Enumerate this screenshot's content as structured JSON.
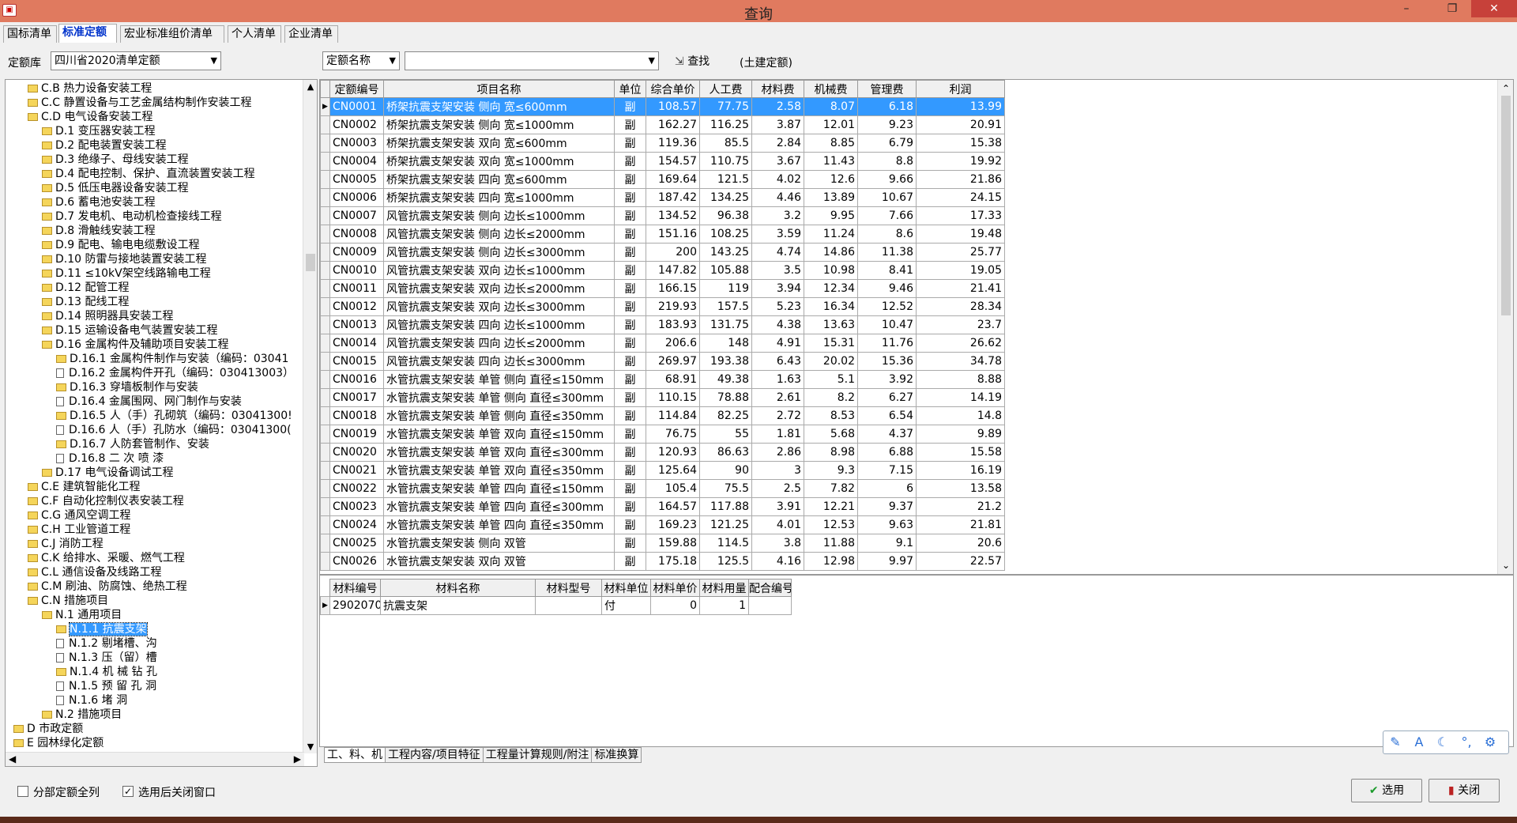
{
  "window": {
    "title": "查询",
    "app_icon": "app-logo-icon",
    "controls": {
      "minimize": "–",
      "maximize": "❐",
      "close": "✕"
    }
  },
  "tabs": [
    {
      "label": "国标清单"
    },
    {
      "label": "标准定额"
    },
    {
      "label": "宏业标准组价清单"
    },
    {
      "label": "个人清单"
    },
    {
      "label": "企业清单"
    }
  ],
  "topbar": {
    "library_label": "定额库",
    "library_value": "四川省2020清单定额",
    "field_value": "定额名称",
    "search_value": "",
    "find_label": "查找",
    "scope_text": "(土建定额)"
  },
  "tree": [
    {
      "label": "C.B 热力设备安装工程",
      "level": 2,
      "type": "folder"
    },
    {
      "label": "C.C 静置设备与工艺金属结构制作安装工程",
      "level": 2,
      "type": "folder"
    },
    {
      "label": "C.D 电气设备安装工程",
      "level": 2,
      "type": "folder-open"
    },
    {
      "label": "D.1 变压器安装工程",
      "level": 3,
      "type": "folder"
    },
    {
      "label": "D.2 配电装置安装工程",
      "level": 3,
      "type": "folder"
    },
    {
      "label": "D.3 绝缘子、母线安装工程",
      "level": 3,
      "type": "folder"
    },
    {
      "label": "D.4 配电控制、保护、直流装置安装工程",
      "level": 3,
      "type": "folder"
    },
    {
      "label": "D.5 低压电器设备安装工程",
      "level": 3,
      "type": "folder"
    },
    {
      "label": "D.6 蓄电池安装工程",
      "level": 3,
      "type": "folder"
    },
    {
      "label": "D.7 发电机、电动机检查接线工程",
      "level": 3,
      "type": "folder"
    },
    {
      "label": "D.8 滑触线安装工程",
      "level": 3,
      "type": "folder"
    },
    {
      "label": "D.9 配电、输电电缆敷设工程",
      "level": 3,
      "type": "folder"
    },
    {
      "label": "D.10 防雷与接地装置安装工程",
      "level": 3,
      "type": "folder"
    },
    {
      "label": "D.11 ≤10kV架空线路输电工程",
      "level": 3,
      "type": "folder"
    },
    {
      "label": "D.12 配管工程",
      "level": 3,
      "type": "folder"
    },
    {
      "label": "D.13 配线工程",
      "level": 3,
      "type": "folder"
    },
    {
      "label": "D.14 照明器具安装工程",
      "level": 3,
      "type": "folder"
    },
    {
      "label": "D.15 运输设备电气装置安装工程",
      "level": 3,
      "type": "folder"
    },
    {
      "label": "D.16 金属构件及辅助项目安装工程",
      "level": 3,
      "type": "folder-open"
    },
    {
      "label": "D.16.1 金属构件制作与安装（编码：03041",
      "level": 4,
      "type": "folder"
    },
    {
      "label": "D.16.2 金属构件开孔（编码：030413003）",
      "level": 4,
      "type": "doc"
    },
    {
      "label": "D.16.3 穿墙板制作与安装",
      "level": 4,
      "type": "folder"
    },
    {
      "label": "D.16.4 金属围网、网门制作与安装",
      "level": 4,
      "type": "doc"
    },
    {
      "label": "D.16.5 人（手）孔砌筑（编码：03041300!",
      "level": 4,
      "type": "folder"
    },
    {
      "label": "D.16.6 人（手）孔防水（编码：03041300(",
      "level": 4,
      "type": "doc"
    },
    {
      "label": "D.16.7 人防套管制作、安装",
      "level": 4,
      "type": "folder"
    },
    {
      "label": "D.16.8 二 次 喷 漆",
      "level": 4,
      "type": "doc"
    },
    {
      "label": "D.17 电气设备调试工程",
      "level": 3,
      "type": "folder"
    },
    {
      "label": "C.E 建筑智能化工程",
      "level": 2,
      "type": "folder"
    },
    {
      "label": "C.F 自动化控制仪表安装工程",
      "level": 2,
      "type": "folder"
    },
    {
      "label": "C.G 通风空调工程",
      "level": 2,
      "type": "folder"
    },
    {
      "label": "C.H 工业管道工程",
      "level": 2,
      "type": "folder"
    },
    {
      "label": "C.J 消防工程",
      "level": 2,
      "type": "folder"
    },
    {
      "label": "C.K 给排水、采暖、燃气工程",
      "level": 2,
      "type": "folder"
    },
    {
      "label": "C.L 通信设备及线路工程",
      "level": 2,
      "type": "folder"
    },
    {
      "label": "C.M 刷油、防腐蚀、绝热工程",
      "level": 2,
      "type": "folder"
    },
    {
      "label": "C.N 措施项目",
      "level": 2,
      "type": "folder-open"
    },
    {
      "label": "N.1 通用项目",
      "level": 3,
      "type": "folder-open"
    },
    {
      "label": "N.1.1 抗震支架",
      "level": 4,
      "type": "folder",
      "selected": true
    },
    {
      "label": "N.1.2 剔堵槽、沟",
      "level": 4,
      "type": "doc"
    },
    {
      "label": "N.1.3 压（留）槽",
      "level": 4,
      "type": "doc"
    },
    {
      "label": "N.1.4 机 械 钻 孔",
      "level": 4,
      "type": "folder"
    },
    {
      "label": "N.1.5 预 留 孔 洞",
      "level": 4,
      "type": "doc"
    },
    {
      "label": "N.1.6 堵   洞",
      "level": 4,
      "type": "doc"
    },
    {
      "label": "N.2 措施项目",
      "level": 3,
      "type": "folder"
    },
    {
      "label": "D 市政定额",
      "level": 1,
      "type": "folder"
    },
    {
      "label": "E 园林绿化定额",
      "level": 1,
      "type": "folder"
    }
  ],
  "grid": {
    "columns": [
      "定额编号",
      "项目名称",
      "单位",
      "综合单价",
      "人工费",
      "材料费",
      "机械费",
      "管理费",
      "利润"
    ],
    "rows": [
      [
        "CN0001",
        "桥架抗震支架安装 侧向 宽≤600mm",
        "副",
        "108.57",
        "77.75",
        "2.58",
        "8.07",
        "6.18",
        "13.99"
      ],
      [
        "CN0002",
        "桥架抗震支架安装 侧向 宽≤1000mm",
        "副",
        "162.27",
        "116.25",
        "3.87",
        "12.01",
        "9.23",
        "20.91"
      ],
      [
        "CN0003",
        "桥架抗震支架安装 双向 宽≤600mm",
        "副",
        "119.36",
        "85.5",
        "2.84",
        "8.85",
        "6.79",
        "15.38"
      ],
      [
        "CN0004",
        "桥架抗震支架安装 双向 宽≤1000mm",
        "副",
        "154.57",
        "110.75",
        "3.67",
        "11.43",
        "8.8",
        "19.92"
      ],
      [
        "CN0005",
        "桥架抗震支架安装 四向 宽≤600mm",
        "副",
        "169.64",
        "121.5",
        "4.02",
        "12.6",
        "9.66",
        "21.86"
      ],
      [
        "CN0006",
        "桥架抗震支架安装 四向 宽≤1000mm",
        "副",
        "187.42",
        "134.25",
        "4.46",
        "13.89",
        "10.67",
        "24.15"
      ],
      [
        "CN0007",
        "风管抗震支架安装 侧向 边长≤1000mm",
        "副",
        "134.52",
        "96.38",
        "3.2",
        "9.95",
        "7.66",
        "17.33"
      ],
      [
        "CN0008",
        "风管抗震支架安装 侧向 边长≤2000mm",
        "副",
        "151.16",
        "108.25",
        "3.59",
        "11.24",
        "8.6",
        "19.48"
      ],
      [
        "CN0009",
        "风管抗震支架安装 侧向 边长≤3000mm",
        "副",
        "200",
        "143.25",
        "4.74",
        "14.86",
        "11.38",
        "25.77"
      ],
      [
        "CN0010",
        "风管抗震支架安装 双向 边长≤1000mm",
        "副",
        "147.82",
        "105.88",
        "3.5",
        "10.98",
        "8.41",
        "19.05"
      ],
      [
        "CN0011",
        "风管抗震支架安装 双向 边长≤2000mm",
        "副",
        "166.15",
        "119",
        "3.94",
        "12.34",
        "9.46",
        "21.41"
      ],
      [
        "CN0012",
        "风管抗震支架安装 双向 边长≤3000mm",
        "副",
        "219.93",
        "157.5",
        "5.23",
        "16.34",
        "12.52",
        "28.34"
      ],
      [
        "CN0013",
        "风管抗震支架安装 四向 边长≤1000mm",
        "副",
        "183.93",
        "131.75",
        "4.38",
        "13.63",
        "10.47",
        "23.7"
      ],
      [
        "CN0014",
        "风管抗震支架安装 四向 边长≤2000mm",
        "副",
        "206.6",
        "148",
        "4.91",
        "15.31",
        "11.76",
        "26.62"
      ],
      [
        "CN0015",
        "风管抗震支架安装 四向 边长≤3000mm",
        "副",
        "269.97",
        "193.38",
        "6.43",
        "20.02",
        "15.36",
        "34.78"
      ],
      [
        "CN0016",
        "水管抗震支架安装 单管 侧向 直径≤150mm",
        "副",
        "68.91",
        "49.38",
        "1.63",
        "5.1",
        "3.92",
        "8.88"
      ],
      [
        "CN0017",
        "水管抗震支架安装 单管 侧向 直径≤300mm",
        "副",
        "110.15",
        "78.88",
        "2.61",
        "8.2",
        "6.27",
        "14.19"
      ],
      [
        "CN0018",
        "水管抗震支架安装 单管 侧向 直径≤350mm",
        "副",
        "114.84",
        "82.25",
        "2.72",
        "8.53",
        "6.54",
        "14.8"
      ],
      [
        "CN0019",
        "水管抗震支架安装 单管 双向 直径≤150mm",
        "副",
        "76.75",
        "55",
        "1.81",
        "5.68",
        "4.37",
        "9.89"
      ],
      [
        "CN0020",
        "水管抗震支架安装 单管 双向 直径≤300mm",
        "副",
        "120.93",
        "86.63",
        "2.86",
        "8.98",
        "6.88",
        "15.58"
      ],
      [
        "CN0021",
        "水管抗震支架安装 单管 双向 直径≤350mm",
        "副",
        "125.64",
        "90",
        "3",
        "9.3",
        "7.15",
        "16.19"
      ],
      [
        "CN0022",
        "水管抗震支架安装 单管 四向 直径≤150mm",
        "副",
        "105.4",
        "75.5",
        "2.5",
        "7.82",
        "6",
        "13.58"
      ],
      [
        "CN0023",
        "水管抗震支架安装 单管 四向 直径≤300mm",
        "副",
        "164.57",
        "117.88",
        "3.91",
        "12.21",
        "9.37",
        "21.2"
      ],
      [
        "CN0024",
        "水管抗震支架安装 单管 四向 直径≤350mm",
        "副",
        "169.23",
        "121.25",
        "4.01",
        "12.53",
        "9.63",
        "21.81"
      ],
      [
        "CN0025",
        "水管抗震支架安装 侧向 双管",
        "副",
        "159.88",
        "114.5",
        "3.8",
        "11.88",
        "9.1",
        "20.6"
      ],
      [
        "CN0026",
        "水管抗震支架安装 双向 双管",
        "副",
        "175.18",
        "125.5",
        "4.16",
        "12.98",
        "9.97",
        "22.57"
      ]
    ]
  },
  "materials": {
    "columns": [
      "材料编号",
      "材料名称",
      "材料型号",
      "材料单位",
      "材料单价",
      "材料用量",
      "配合编号"
    ],
    "rows": [
      [
        "2902070",
        "抗震支架",
        "",
        "付",
        "0",
        "1",
        ""
      ]
    ]
  },
  "bottom_tabs": [
    {
      "label": "工、料、机"
    },
    {
      "label": "工程内容/项目特征"
    },
    {
      "label": "工程量计算规则/附注"
    },
    {
      "label": "标准换算"
    }
  ],
  "bottom": {
    "check1_label": "分部定额全列",
    "check1": false,
    "check2_label": "选用后关闭窗口",
    "check2": true,
    "select_label": "选用",
    "close_label": "关闭"
  },
  "floatbar": {
    "icons": [
      "pen-edit-icon",
      "font-icon",
      "moon-icon",
      "voice-icon",
      "gear-icon"
    ]
  }
}
